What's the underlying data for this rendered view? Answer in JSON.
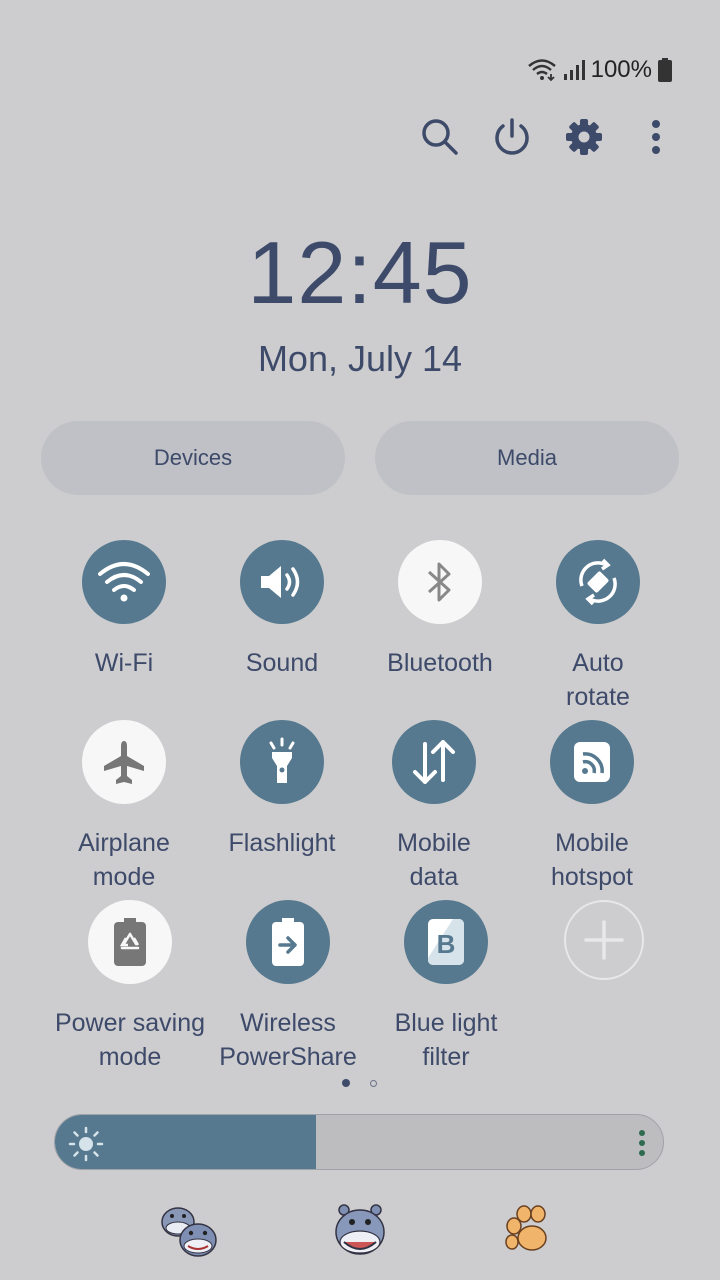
{
  "status": {
    "battery_text": "100%",
    "icons": [
      "wifi-icon",
      "signal-icon",
      "battery-icon"
    ]
  },
  "top_actions": [
    "search-icon",
    "power-icon",
    "settings-gear-icon",
    "more-vert-icon"
  ],
  "clock": {
    "time": "12:45",
    "date": "Mon, July 14"
  },
  "pills": {
    "devices": "Devices",
    "media": "Media"
  },
  "tiles": [
    {
      "label": "Wi-Fi",
      "on": true
    },
    {
      "label": "Sound",
      "on": true
    },
    {
      "label": "Bluetooth",
      "on": false
    },
    {
      "label": "Auto\nrotate",
      "on": true
    },
    {
      "label": "Airplane\nmode",
      "on": false
    },
    {
      "label": "Flashlight",
      "on": true
    },
    {
      "label": "Mobile\ndata",
      "on": true
    },
    {
      "label": "Mobile\nhotspot",
      "on": true
    },
    {
      "label": "Power saving\nmode",
      "on": false
    },
    {
      "label": "Wireless\nPowerShare",
      "on": true
    },
    {
      "label": "Blue light\nfilter",
      "on": true
    }
  ],
  "pager": {
    "pages": 2,
    "current": 1
  },
  "brightness": {
    "level": 0.43
  },
  "colors": {
    "accent": "#56798f",
    "text": "#3e4a6a",
    "background": "#cdcdcf",
    "tile_off": "#f7f7f7"
  },
  "dock_apps": [
    "hippo-pair-icon",
    "hippo-icon",
    "paw-icon"
  ]
}
